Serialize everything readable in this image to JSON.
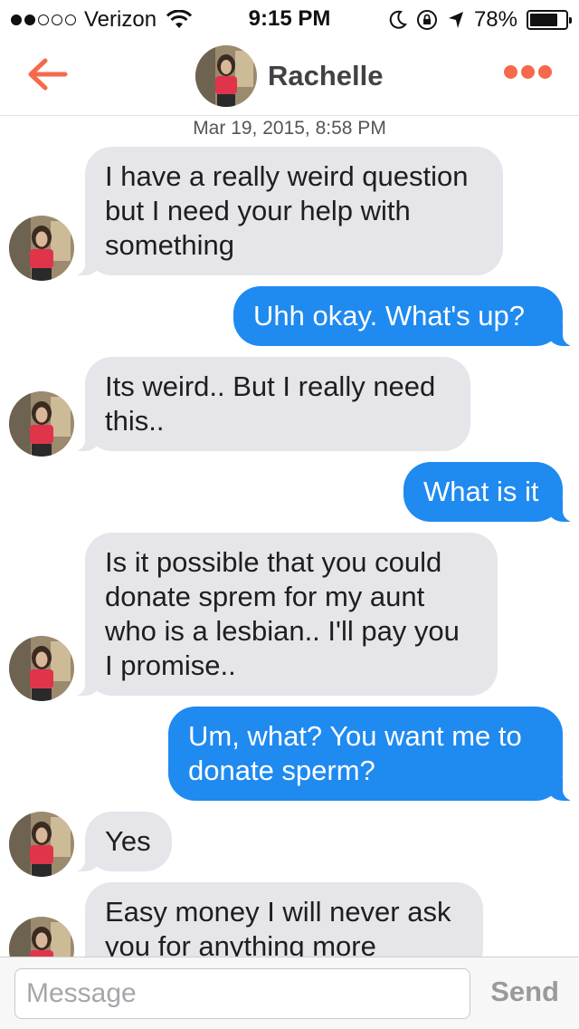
{
  "status_bar": {
    "carrier": "Verizon",
    "time": "9:15 PM",
    "battery": "78%",
    "battery_level": 0.78,
    "signal_bars": 2,
    "signal_total": 5
  },
  "header": {
    "contact_name": "Rachelle",
    "back_icon": "arrow-left-icon",
    "more_icon": "more-dots-icon",
    "accent_color": "#f56a4c"
  },
  "conversation": {
    "timestamp": "Mar 19, 2015, 8:58 PM",
    "messages": [
      {
        "direction": "in",
        "text": "I have a really weird question\nbut I need your help with\nsomething"
      },
      {
        "direction": "out",
        "text": "Uhh okay. What's up?"
      },
      {
        "direction": "in",
        "text": "Its weird.. But I really need\nthis.."
      },
      {
        "direction": "out",
        "text": "What is it"
      },
      {
        "direction": "in",
        "text": "Is it possible that you could\ndonate sprem for my aunt\nwho is a lesbian.. I'll pay you\nI promise.."
      },
      {
        "direction": "out",
        "text": "Um, what? You want me to\ndonate sperm?"
      },
      {
        "direction": "in",
        "text": "Yes"
      },
      {
        "direction": "in",
        "text": "Easy money I will never ask\nyou for anything more"
      }
    ]
  },
  "composer": {
    "placeholder": "Message",
    "value": "",
    "send_label": "Send"
  },
  "colors": {
    "incoming_bubble": "#e5e5ea",
    "outgoing_bubble": "#1f8af0"
  }
}
